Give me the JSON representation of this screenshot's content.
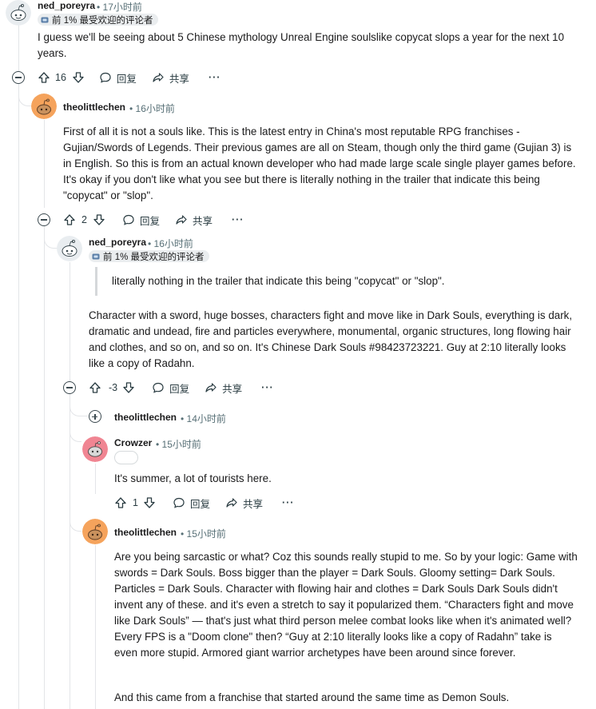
{
  "comments": [
    {
      "id": "c1",
      "username": "ned_poreyra",
      "time": "17小时前",
      "flair": "前 1% 最受欢迎的评论者",
      "body": "I guess we'll be seeing about 5 Chinese mythology Unreal Engine soulslike copycat slops a year for the next 10 years.",
      "votes": "16",
      "reply_label": "回复",
      "share_label": "共享",
      "more_label": "···"
    },
    {
      "id": "c2",
      "username": "theolittlechen",
      "time": "16小时前",
      "body": "First of all it is not a souls like. This is the latest entry in China's most reputable RPG franchises - Gujian/Swords of Legends. Their previous games are all on Steam, though only the third game (Gujian 3) is in English. So this is from an actual known developer who had made large scale single player games before. It's okay if you don't like what you see but there is literally nothing in the trailer that indicate this being \"copycat\" or \"slop\".",
      "votes": "2",
      "reply_label": "回复",
      "share_label": "共享",
      "more_label": "···"
    },
    {
      "id": "c3",
      "username": "ned_poreyra",
      "time": "16小时前",
      "flair": "前 1% 最受欢迎的评论者",
      "quote": "literally nothing in the trailer that indicate this being \"copycat\" or \"slop\".",
      "body": "Character with a sword, huge bosses, characters fight and move like in Dark Souls, everything is dark, dramatic and undead, fire and particles everywhere, monumental, organic structures, long flowing hair and clothes, and so on, and so on. It's Chinese Dark Souls #98423723221. Guy at 2:10 literally looks like a copy of Radahn.",
      "votes": "-3",
      "reply_label": "回复",
      "share_label": "共享",
      "more_label": "···"
    },
    {
      "id": "c4",
      "username": "theolittlechen",
      "time": "14小时前"
    },
    {
      "id": "c5",
      "username": "Crowzer",
      "time": "15小时前",
      "body": "It's summer, a lot of tourists here.",
      "votes": "1",
      "reply_label": "回复",
      "share_label": "共享",
      "more_label": "···"
    },
    {
      "id": "c6",
      "username": "theolittlechen",
      "time": "15小时前",
      "body": "Are you being sarcastic or what? Coz this sounds really stupid to me. So by your logic: Game with swords = Dark Souls. Boss bigger than the player = Dark Souls. Gloomy setting= Dark Souls. Particles = Dark Souls. Character with flowing hair and clothes = Dark Souls Dark Souls didn't invent any of these. and it's even a stretch to say it popularized them. “Characters fight and move like Dark Souls” — that's just what third person melee combat looks like when it's animated well? Every FPS is a \"Doom clone\" then? “Guy at 2:10 literally looks like a copy of Radahn” take is even more stupid. Armored giant warrior archetypes have been around since forever.",
      "body2": "And this came from a franchise that started around the same time as Demon Souls."
    }
  ],
  "separator": "•",
  "colors": {
    "text": "#1a1a1b",
    "meta": "#576f76",
    "flair_bg": "#eaedef",
    "thread_line": "#e3e5e8",
    "crowzer_avatar": "#f08592",
    "theo_avatar": "#f5a35c"
  },
  "icons": [
    "snoo-avatar-icon",
    "collapse-icon",
    "expand-icon",
    "upvote-icon",
    "downvote-icon",
    "comment-icon",
    "share-icon",
    "more-icon",
    "flair-badge-icon"
  ]
}
